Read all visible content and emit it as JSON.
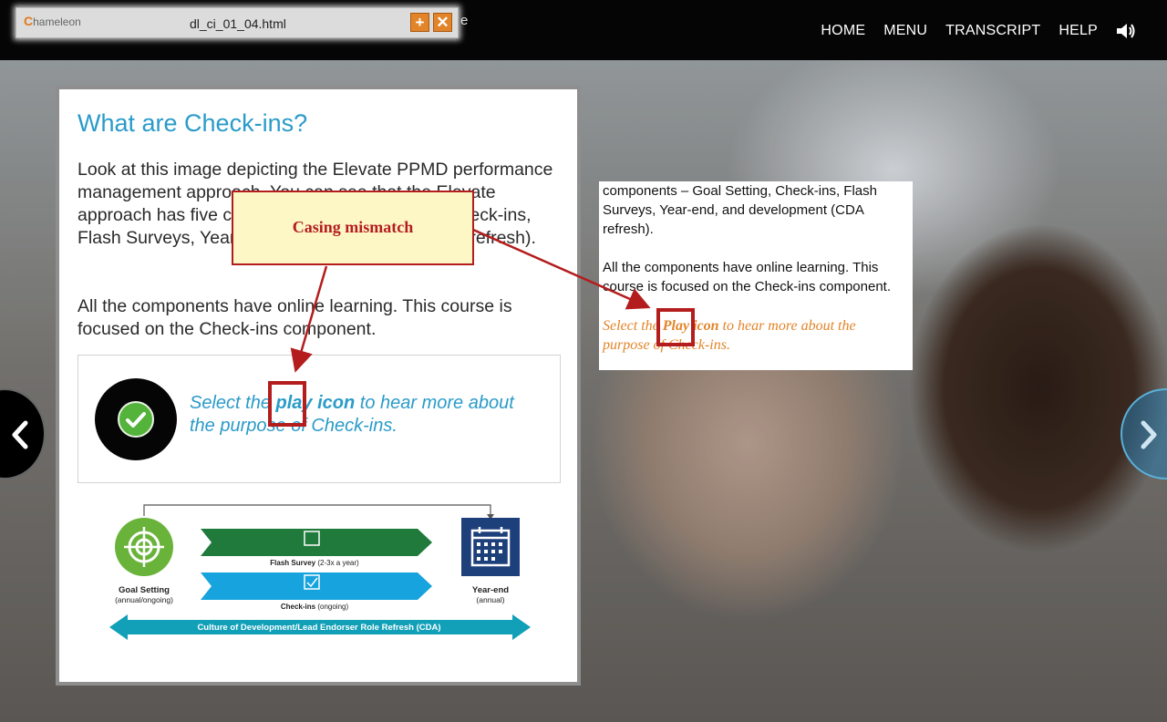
{
  "topbar": {
    "nav": [
      "HOME",
      "MENU",
      "TRANSCRIPT",
      "HELP"
    ],
    "sound_icon": "speaker-icon"
  },
  "tool_window": {
    "logo_first": "C",
    "logo_rest": "hameleon",
    "filename": "dl_ci_01_04.html",
    "add_icon": "plus-icon",
    "close_icon": "close-icon",
    "behind_text": "e"
  },
  "card": {
    "title": "What are Check-ins?",
    "para1": "Look at this image depicting the Elevate PPMD performance management approach. You can see that the Elevate approach has five components – Goal Setting, Check-ins, Flash Surveys, Year-end, and development (CDA refresh).",
    "para2": "All the components have online learning. This course is focused on the Check-ins component.",
    "play_prefix": "Select the ",
    "play_bold": "play icon",
    "play_suffix": " to hear more about the purpose of Check-ins."
  },
  "diagram": {
    "goal_title": "Goal Setting",
    "goal_sub": "(annual/ongoing)",
    "flash_title": "Flash Survey",
    "flash_sub": "(2-3x a year)",
    "checkins_title": "Check-ins",
    "checkins_sub": "(ongoing)",
    "year_title": "Year-end",
    "year_sub": "(annual)",
    "cda": "Culture of Development/Lead Endorser Role Refresh (CDA)",
    "colors": {
      "green": "#6ab33a",
      "dark_green": "#1f7a3c",
      "blue": "#17a3dd",
      "navy": "#1d3f7a",
      "teal": "#12a0b8"
    }
  },
  "snippet": {
    "para_a": "components – Goal Setting, Check-ins, Flash Surveys, Year-end, and development (CDA refresh).",
    "para_b": "All the components have online learning. This course is focused on the Check-ins component.",
    "play_prefix": "Select the ",
    "play_bold": "Play icon",
    "play_suffix": " to hear more about the purpose of Check-ins."
  },
  "annotation": {
    "label": "Casing mismatch",
    "color": "#b41d1d"
  },
  "nav_arrows": {
    "prev_icon": "chevron-left-icon",
    "next_icon": "chevron-right-icon"
  }
}
